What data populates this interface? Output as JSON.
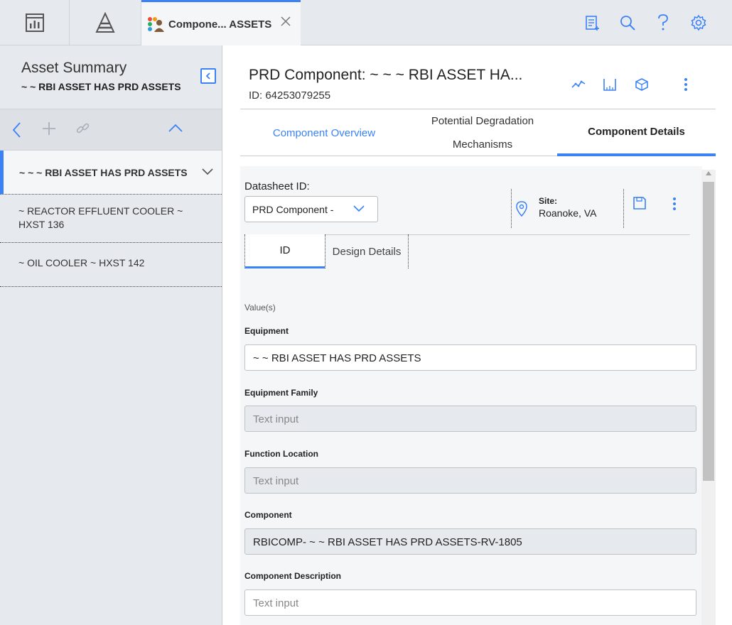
{
  "topbar": {
    "tab_label": "Compone... ASSETS",
    "icons": [
      "dashboard-icon",
      "pyramid-icon",
      "clipboard-icon",
      "search-icon",
      "help-icon",
      "gear-icon"
    ]
  },
  "asset_summary": {
    "title": "Asset Summary",
    "subtitle": "~ ~ RBI ASSET HAS PRD ASSETS",
    "items": [
      {
        "label": "~ ~ ~ RBI ASSET HAS PRD ASSETS",
        "selected": true
      },
      {
        "label": "~ REACTOR EFFLUENT COOLER ~ HXST 136",
        "selected": false
      },
      {
        "label": "~ OIL COOLER ~ HXST 142",
        "selected": false
      }
    ]
  },
  "header": {
    "title": "PRD Component: ~ ~ ~ RBI ASSET HA...",
    "id_text": "ID: 64253079255"
  },
  "tabs": {
    "overview": "Component Overview",
    "degradation": "Potential Degradation Mechanisms",
    "details": "Component Details"
  },
  "datasheet": {
    "label": "Datasheet ID:",
    "selected": "PRD Component -",
    "site_label": "Site:",
    "site_value": "Roanoke, VA"
  },
  "subtabs": {
    "id": "ID",
    "design": "Design Details"
  },
  "form": {
    "values_label": "Value(s)",
    "equipment_label": "Equipment",
    "equipment_value": "~  ~ RBI ASSET HAS PRD ASSETS",
    "equipment_family_label": "Equipment Family",
    "equipment_family_placeholder": "Text input",
    "function_location_label": "Function Location",
    "function_location_placeholder": "Text input",
    "component_label": "Component",
    "component_value": "RBICOMP- ~  ~ RBI ASSET HAS PRD ASSETS-RV-1805",
    "component_description_label": "Component Description",
    "component_description_placeholder": "Text input"
  },
  "colors": {
    "accent": "#3b82f6",
    "panel": "#e6e9ee"
  }
}
